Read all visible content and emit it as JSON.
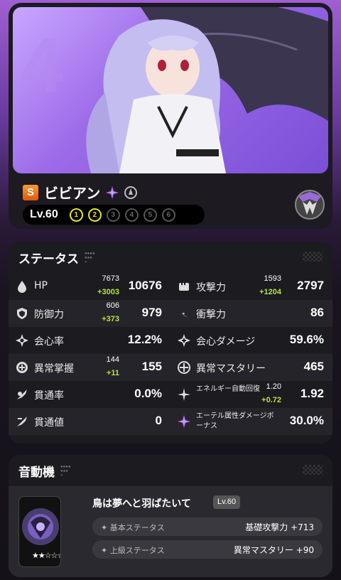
{
  "character": {
    "rank": "S",
    "name": "ビビアン",
    "level": "Lv.60",
    "mindscapes": [
      "1",
      "2",
      "3",
      "4",
      "5",
      "6"
    ],
    "mindscapes_active": 2
  },
  "stats": {
    "title": "ステータス",
    "rows": [
      [
        {
          "label": "HP",
          "base": "7673",
          "bonus": "+3003",
          "value": "10676",
          "icon": "hp-icon"
        },
        {
          "label": "攻撃力",
          "base": "1593",
          "bonus": "+1204",
          "value": "2797",
          "icon": "attack-icon"
        }
      ],
      [
        {
          "label": "防御力",
          "base": "606",
          "bonus": "+373",
          "value": "979",
          "icon": "defense-icon"
        },
        {
          "label": "衝撃力",
          "base": "",
          "bonus": "",
          "value": "86",
          "icon": "impact-icon"
        }
      ],
      [
        {
          "label": "会心率",
          "base": "",
          "bonus": "",
          "value": "12.2%",
          "icon": "crit-rate-icon"
        },
        {
          "label": "会心ダメージ",
          "base": "",
          "bonus": "",
          "value": "59.6%",
          "icon": "crit-dmg-icon"
        }
      ],
      [
        {
          "label": "異常掌握",
          "base": "144",
          "bonus": "+11",
          "value": "155",
          "icon": "anomaly-proficiency-icon"
        },
        {
          "label": "異常マスタリー",
          "base": "",
          "bonus": "",
          "value": "465",
          "icon": "anomaly-mastery-icon"
        }
      ],
      [
        {
          "label": "貫通率",
          "base": "",
          "bonus": "",
          "value": "0.0%",
          "icon": "pen-ratio-icon"
        },
        {
          "label": "エネルギー自動回復",
          "base": "1.20",
          "bonus": "+0.72",
          "value": "1.92",
          "icon": "energy-regen-icon"
        }
      ],
      [
        {
          "label": "貫通値",
          "base": "",
          "bonus": "",
          "value": "0",
          "icon": "pen-icon"
        },
        {
          "label": "エーテル属性ダメージボーナス",
          "base": "",
          "bonus": "",
          "value": "30.0%",
          "icon": "ether-dmg-icon"
        }
      ]
    ]
  },
  "engine": {
    "title": "音動機",
    "name": "鳥は夢へと羽ばたいて",
    "level": "Lv.60",
    "main_stat_label": "基本ステータス",
    "main_stat_value": "基礎攻撃力 +713",
    "sub_stat_label": "上級ステータス",
    "sub_stat_value": "異常マスタリー +90",
    "stars": "★★☆☆☆"
  },
  "colors": {
    "accent_yellow": "#e6e61a",
    "bonus_green": "#b6e63a",
    "panel": "#1c1b20",
    "portrait_purple": "#9c6be8"
  }
}
